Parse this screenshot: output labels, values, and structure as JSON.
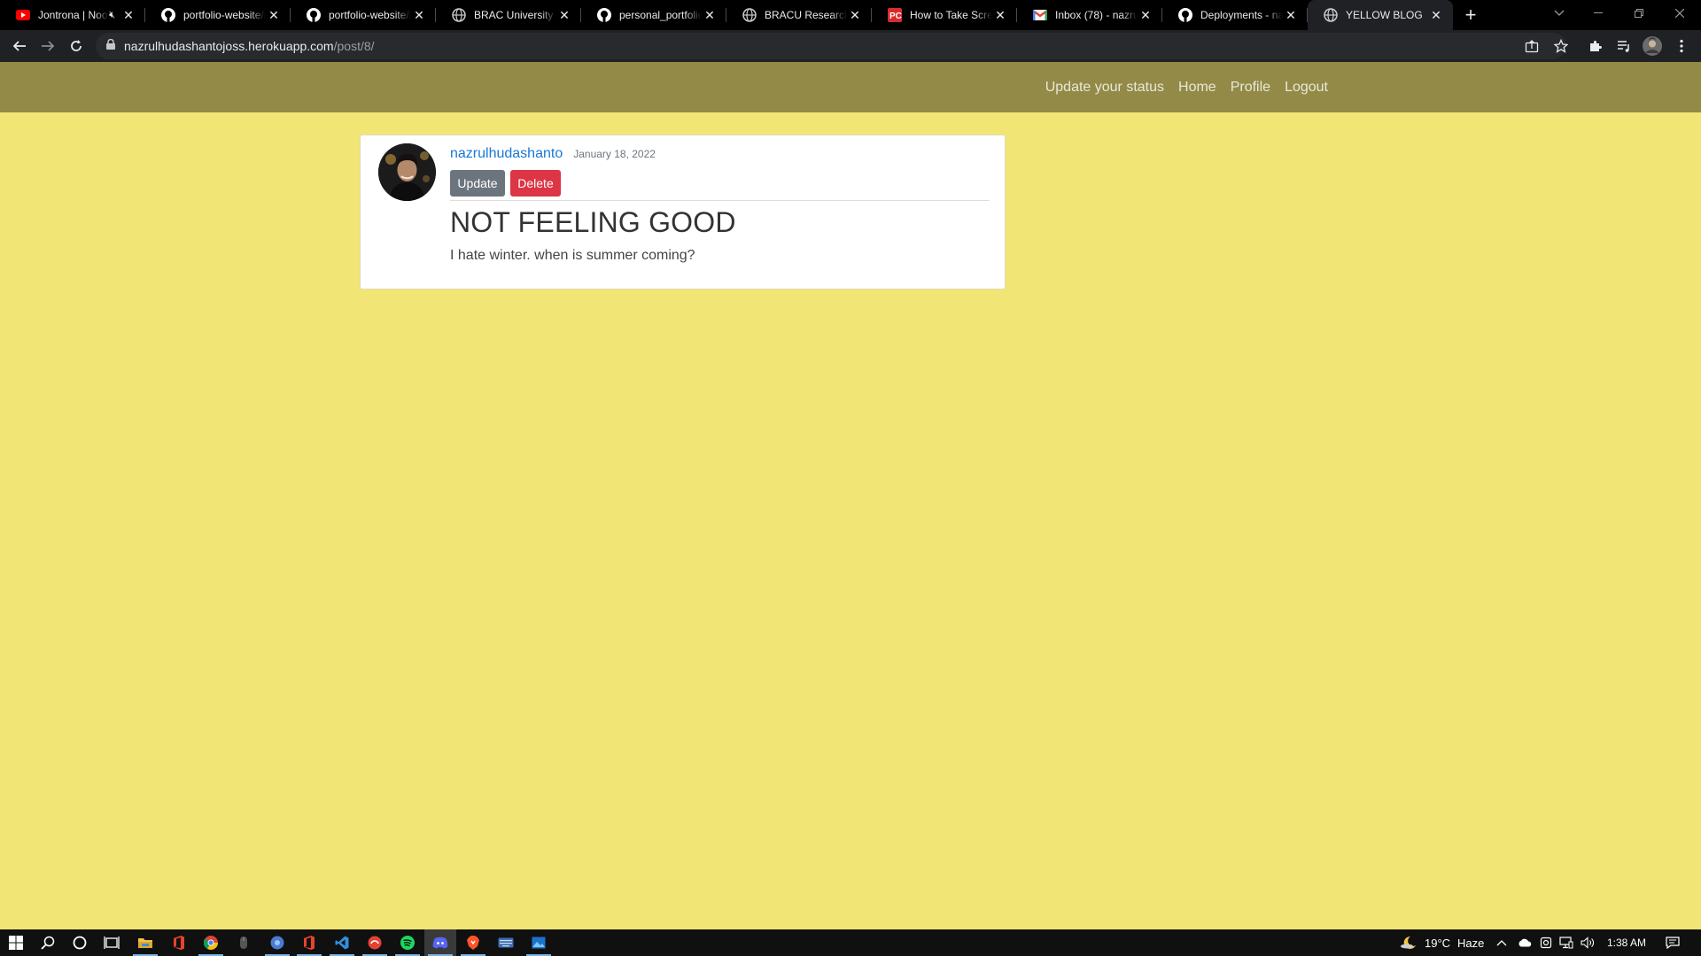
{
  "browser": {
    "tabs": [
      {
        "title": "Jontrona | Noo",
        "icon": "youtube-icon",
        "muted": true
      },
      {
        "title": "portfolio-website/i",
        "icon": "github-icon"
      },
      {
        "title": "portfolio-website/i",
        "icon": "github-icon"
      },
      {
        "title": "BRAC University",
        "icon": "globe-icon"
      },
      {
        "title": "personal_portfolio",
        "icon": "github-icon"
      },
      {
        "title": "BRACU Researcher",
        "icon": "globe-icon"
      },
      {
        "title": "How to Take Scree",
        "icon": "pc-icon"
      },
      {
        "title": "Inbox (78) - nazrul",
        "icon": "gmail-icon"
      },
      {
        "title": "Deployments - naz",
        "icon": "github-icon"
      },
      {
        "title": "YELLOW BLOG",
        "icon": "globe-icon",
        "active": true
      }
    ],
    "new_tab": "+",
    "url_host": "nazrulhudashantojoss.herokuapp.com",
    "url_path": "/post/8/"
  },
  "site": {
    "nav_links": [
      "Update your status",
      "Home",
      "Profile",
      "Logout"
    ]
  },
  "post": {
    "author": "nazrulhudashanto",
    "date": "January 18, 2022",
    "update_label": "Update",
    "delete_label": "Delete",
    "title": "NOT FEELING GOOD",
    "content": "I hate winter. when is summer coming?"
  },
  "taskbar": {
    "weather": "19°C",
    "weather_desc": "Haze",
    "time": "1:38 AM"
  },
  "colors": {
    "page_bg": "#f0e575",
    "navbar_bg": "#938a48",
    "link": "#1877d6",
    "btn_secondary": "#6c757d",
    "btn_danger": "#dc3545"
  }
}
